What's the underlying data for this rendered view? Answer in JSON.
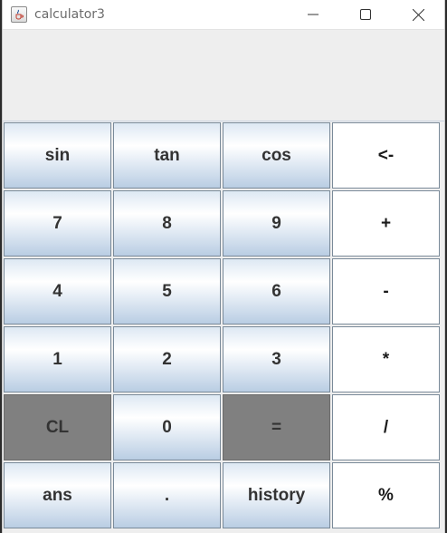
{
  "window": {
    "title": "calculator3",
    "display_value": ""
  },
  "keypad": [
    {
      "label": "sin",
      "name": "sin-button",
      "style": "blue"
    },
    {
      "label": "tan",
      "name": "tan-button",
      "style": "blue"
    },
    {
      "label": "cos",
      "name": "cos-button",
      "style": "blue"
    },
    {
      "label": "<-",
      "name": "backspace-button",
      "style": "white"
    },
    {
      "label": "7",
      "name": "digit-7-button",
      "style": "blue"
    },
    {
      "label": "8",
      "name": "digit-8-button",
      "style": "blue"
    },
    {
      "label": "9",
      "name": "digit-9-button",
      "style": "blue"
    },
    {
      "label": "+",
      "name": "add-button",
      "style": "white"
    },
    {
      "label": "4",
      "name": "digit-4-button",
      "style": "blue"
    },
    {
      "label": "5",
      "name": "digit-5-button",
      "style": "blue"
    },
    {
      "label": "6",
      "name": "digit-6-button",
      "style": "blue"
    },
    {
      "label": "-",
      "name": "subtract-button",
      "style": "white"
    },
    {
      "label": "1",
      "name": "digit-1-button",
      "style": "blue"
    },
    {
      "label": "2",
      "name": "digit-2-button",
      "style": "blue"
    },
    {
      "label": "3",
      "name": "digit-3-button",
      "style": "blue"
    },
    {
      "label": "*",
      "name": "multiply-button",
      "style": "white"
    },
    {
      "label": "CL",
      "name": "clear-button",
      "style": "gray"
    },
    {
      "label": "0",
      "name": "digit-0-button",
      "style": "blue"
    },
    {
      "label": "=",
      "name": "equals-button",
      "style": "gray"
    },
    {
      "label": "/",
      "name": "divide-button",
      "style": "white"
    },
    {
      "label": "ans",
      "name": "ans-button",
      "style": "blue"
    },
    {
      "label": ".",
      "name": "decimal-button",
      "style": "blue"
    },
    {
      "label": "history",
      "name": "history-button",
      "style": "blue"
    },
    {
      "label": "%",
      "name": "percent-button",
      "style": "white"
    }
  ],
  "colors": {
    "accent_gray": "#808080",
    "button_gradient_bottom": "#b9cde3",
    "operator_bg": "#ffffff"
  },
  "icons": {
    "app": "java-cup-icon",
    "minimize": "minimize-icon",
    "maximize": "maximize-icon",
    "close": "close-icon"
  }
}
